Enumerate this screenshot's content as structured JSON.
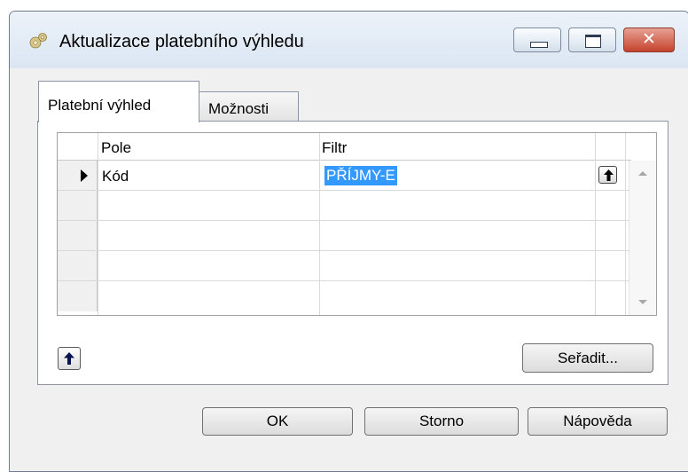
{
  "window": {
    "title": "Aktualizace platebního výhledu",
    "icon": "gear-icon",
    "controls": {
      "minimize": "minimize-icon",
      "maximize": "maximize-icon",
      "close": "✕"
    }
  },
  "tabs": [
    {
      "label": "Platební výhled",
      "active": true
    },
    {
      "label": "Možnosti",
      "active": false
    }
  ],
  "grid": {
    "columns": [
      "Pole",
      "Filtr"
    ],
    "rows": [
      {
        "field": "Kód",
        "filter": "PŘÍJMY-E",
        "current": true,
        "filter_selected": true
      },
      {
        "field": "",
        "filter": ""
      },
      {
        "field": "",
        "filter": ""
      },
      {
        "field": "",
        "filter": ""
      },
      {
        "field": "",
        "filter": ""
      }
    ]
  },
  "panel_buttons": {
    "sort": "Seřadit..."
  },
  "dialog_buttons": {
    "ok": "OK",
    "cancel": "Storno",
    "help": "Nápověda"
  },
  "colors": {
    "selection": "#3399ff",
    "close_button": "#c4432e"
  }
}
